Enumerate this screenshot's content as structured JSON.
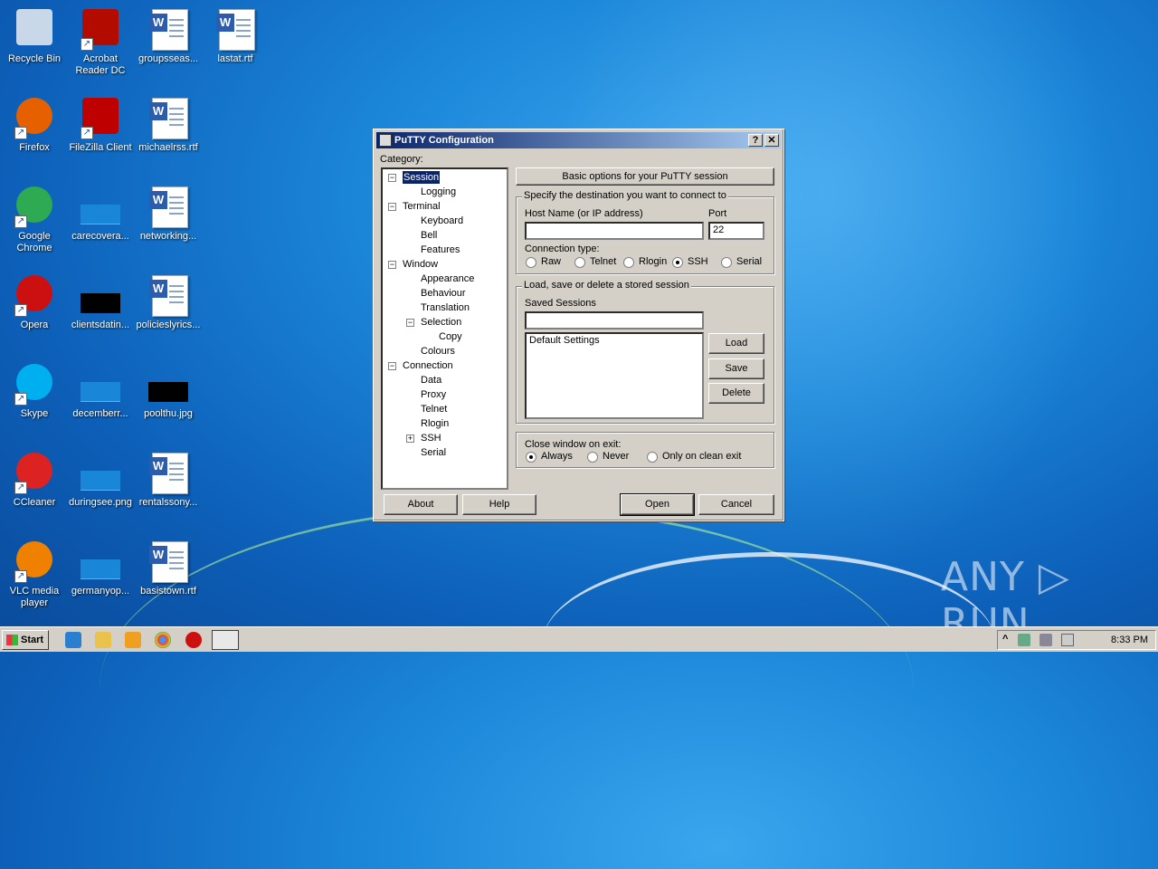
{
  "desktop": {
    "icons": [
      {
        "label": "Recycle Bin",
        "icon": "recycle-bin-icon"
      },
      {
        "label": "Acrobat Reader DC",
        "icon": "acrobat-icon"
      },
      {
        "label": "groupsseas...",
        "icon": "word-doc-icon"
      },
      {
        "label": "lastat.rtf",
        "icon": "word-doc-icon"
      },
      {
        "label": "Firefox",
        "icon": "firefox-icon"
      },
      {
        "label": "FileZilla Client",
        "icon": "filezilla-icon"
      },
      {
        "label": "michaelrss.rtf",
        "icon": "word-doc-icon"
      },
      {
        "label": "Google Chrome",
        "icon": "chrome-icon"
      },
      {
        "label": "carecovera...",
        "icon": "image-file-icon"
      },
      {
        "label": "networking...",
        "icon": "word-doc-icon"
      },
      {
        "label": "Opera",
        "icon": "opera-icon"
      },
      {
        "label": "clientsdatin...",
        "icon": "image-file-icon"
      },
      {
        "label": "policieslyrics...",
        "icon": "word-doc-icon"
      },
      {
        "label": "Skype",
        "icon": "skype-icon"
      },
      {
        "label": "decemberr...",
        "icon": "image-file-icon"
      },
      {
        "label": "poolthu.jpg",
        "icon": "image-file-icon"
      },
      {
        "label": "CCleaner",
        "icon": "ccleaner-icon"
      },
      {
        "label": "duringsee.png",
        "icon": "image-file-icon"
      },
      {
        "label": "rentalssony...",
        "icon": "word-doc-icon"
      },
      {
        "label": "VLC media player",
        "icon": "vlc-icon"
      },
      {
        "label": "germanyop...",
        "icon": "image-file-icon"
      },
      {
        "label": "basistown.rtf",
        "icon": "word-doc-icon"
      }
    ]
  },
  "window": {
    "title": "PuTTY Configuration",
    "help_glyph": "?",
    "close_glyph": "✕",
    "category_label": "Category:",
    "tree": [
      {
        "label": "Session",
        "selected": true
      },
      {
        "label": "Logging"
      },
      {
        "label": "Terminal"
      },
      {
        "label": "Keyboard"
      },
      {
        "label": "Bell"
      },
      {
        "label": "Features"
      },
      {
        "label": "Window"
      },
      {
        "label": "Appearance"
      },
      {
        "label": "Behaviour"
      },
      {
        "label": "Translation"
      },
      {
        "label": "Selection"
      },
      {
        "label": "Copy"
      },
      {
        "label": "Colours"
      },
      {
        "label": "Connection"
      },
      {
        "label": "Data"
      },
      {
        "label": "Proxy"
      },
      {
        "label": "Telnet"
      },
      {
        "label": "Rlogin"
      },
      {
        "label": "SSH"
      },
      {
        "label": "Serial"
      }
    ],
    "panel_header": "Basic options for your PuTTY session",
    "dest_group": "Specify the destination you want to connect to",
    "host_label": "Host Name (or IP address)",
    "host_value": "",
    "port_label": "Port",
    "port_value": "22",
    "conn_type_label": "Connection type:",
    "conn_types": [
      "Raw",
      "Telnet",
      "Rlogin",
      "SSH",
      "Serial"
    ],
    "conn_type_selected": "SSH",
    "sessions_group": "Load, save or delete a stored session",
    "saved_sessions_label": "Saved Sessions",
    "saved_sessions_value": "",
    "sessions_list": [
      "Default Settings"
    ],
    "load_btn": "Load",
    "save_btn": "Save",
    "delete_btn": "Delete",
    "close_group": "Close window on exit:",
    "close_options": [
      "Always",
      "Never",
      "Only on clean exit"
    ],
    "close_selected": "Always",
    "about_btn": "About",
    "help_btn": "Help",
    "open_btn": "Open",
    "cancel_btn": "Cancel"
  },
  "taskbar": {
    "start_label": "Start",
    "clock": "8:33 PM",
    "tray_expand": "^"
  },
  "watermark": "ANY ▷ RUN"
}
